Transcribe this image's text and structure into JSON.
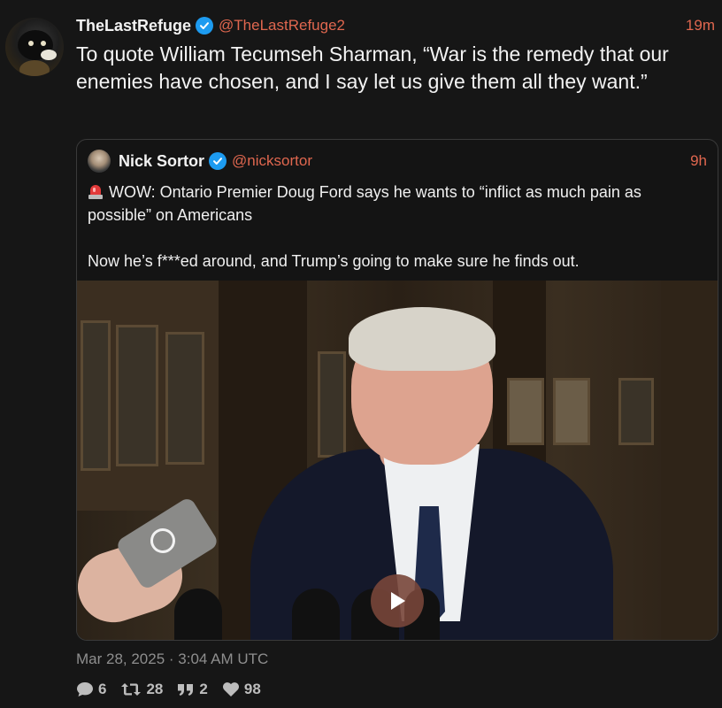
{
  "post": {
    "author_name": "TheLastRefuge",
    "author_handle": "@TheLastRefuge2",
    "time": "19m",
    "text": "To quote William Tecumseh Sharman, “War is the remedy that our enemies have chosen, and I say let us give them all they want.”",
    "date": "Mar 28, 2025 · 3:04 AM UTC",
    "verified_icon": "verified-badge-icon"
  },
  "quote": {
    "author_name": "Nick Sortor",
    "author_handle": "@nicksortor",
    "time": "9h",
    "paragraph1": "WOW: Ontario Premier Doug Ford says he wants to “inflict as much pain as possible” on Americans",
    "paragraph2": "Now he’s f***ed around, and Trump’s going to make sure he finds out.",
    "emoji_icon": "siren-icon",
    "video_icon": "play-icon"
  },
  "stats": {
    "replies": "6",
    "retweets": "28",
    "quotes": "2",
    "likes": "98"
  },
  "colors": {
    "background": "#161616",
    "accent": "#e0674f",
    "verified": "#1d9bf0",
    "muted": "#8e8e8e"
  }
}
